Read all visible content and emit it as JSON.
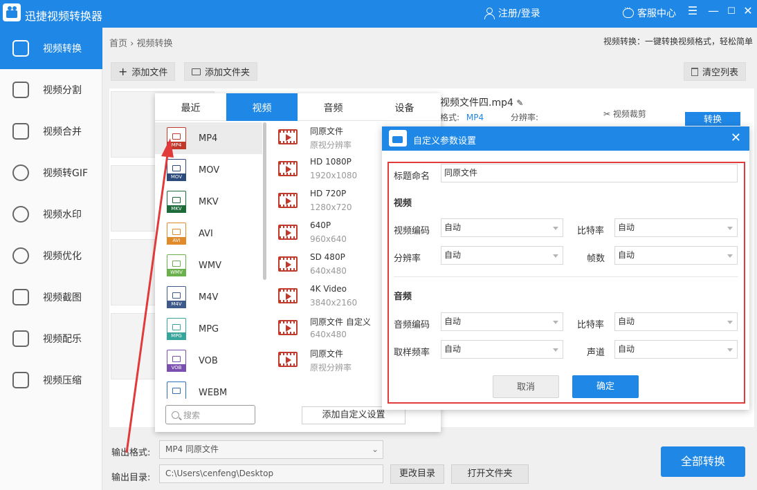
{
  "app": {
    "title": "迅捷视频转换器",
    "login": "注册/登录",
    "service": "客服中心"
  },
  "sidebar": {
    "items": [
      {
        "label": "视频转换"
      },
      {
        "label": "视频分割"
      },
      {
        "label": "视频合并"
      },
      {
        "label": "视频转GIF"
      },
      {
        "label": "视频水印"
      },
      {
        "label": "视频优化"
      },
      {
        "label": "视频截图"
      },
      {
        "label": "视频配乐"
      },
      {
        "label": "视频压缩"
      }
    ]
  },
  "breadcrumb": {
    "home": "首页",
    "current": "视频转换"
  },
  "hint": "视频转换：一键转换视频格式，轻松简单",
  "toolbar": {
    "add_file": "添加文件",
    "add_folder": "添加文件夹",
    "clear_list": "清空列表"
  },
  "file": {
    "name": "视频文件四.mp4",
    "format_label": "格式:",
    "format_value": "MP4",
    "resolution_label": "分辨率:",
    "cut_label": "视频裁剪",
    "convert_label": "转换"
  },
  "format_panel": {
    "tabs": [
      "最近",
      "视频",
      "音频",
      "设备"
    ],
    "formats": [
      "MP4",
      "MOV",
      "MKV",
      "AVI",
      "WMV",
      "M4V",
      "MPG",
      "VOB",
      "WEBM"
    ],
    "presets": [
      {
        "name": "同原文件",
        "sub": "原视分辨率"
      },
      {
        "name": "HD 1080P",
        "sub": "1920x1080"
      },
      {
        "name": "HD 720P",
        "sub": "1280x720"
      },
      {
        "name": "640P",
        "sub": "960x640"
      },
      {
        "name": "SD 480P",
        "sub": "640x480"
      },
      {
        "name": "4K Video",
        "sub": "3840x2160"
      },
      {
        "name": "同原文件 自定义",
        "sub": "640x480"
      },
      {
        "name": "同原文件",
        "sub": "原视分辨率"
      }
    ],
    "search_placeholder": "搜索",
    "add_custom": "添加自定义设置"
  },
  "dialog": {
    "title": "自定义参数设置",
    "name_label": "标题命名",
    "name_value": "同原文件",
    "video_heading": "视频",
    "audio_heading": "音频",
    "video_codec": "视频编码",
    "bitrate": "比特率",
    "resolution": "分辨率",
    "fps": "帧数",
    "audio_codec": "音频编码",
    "sample_rate": "取样频率",
    "channel": "声道",
    "auto": "自动",
    "cancel": "取消",
    "ok": "确定"
  },
  "bottom": {
    "output_format_label": "输出格式:",
    "output_format_value": "MP4   同原文件",
    "output_dir_label": "输出目录:",
    "output_dir_value": "C:\\Users\\cenfeng\\Desktop",
    "change_dir": "更改目录",
    "open_folder": "打开文件夹",
    "convert_all": "全部转换"
  },
  "colors": {
    "accent": "#1f87e6",
    "annotation": "#e03a3a",
    "format_icon": "#c0392b"
  }
}
